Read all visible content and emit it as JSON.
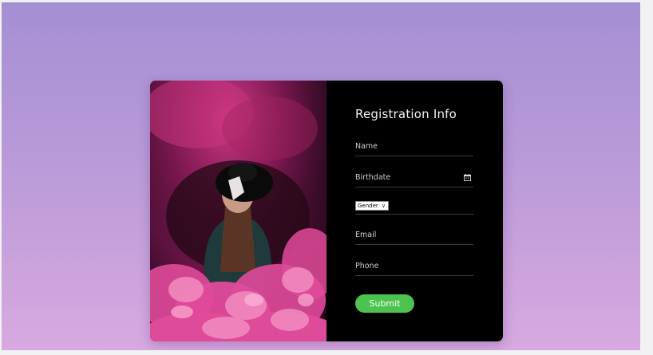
{
  "form": {
    "title": "Registration Info",
    "fields": {
      "name": {
        "placeholder": "Name"
      },
      "birthdate": {
        "placeholder": "Birthdate"
      },
      "gender": {
        "selected": "Gender"
      },
      "email": {
        "placeholder": "Email"
      },
      "phone": {
        "placeholder": "Phone"
      }
    },
    "submit_label": "Submit"
  },
  "colors": {
    "background_top": "#a48fd4",
    "background_bottom": "#d8a9e0",
    "form_panel": "#000000",
    "submit_button": "#4cc34f",
    "smoke": "#e04a9a"
  },
  "icons": {
    "birthdate": "calendar-icon",
    "gender": "chevron-down-icon"
  }
}
